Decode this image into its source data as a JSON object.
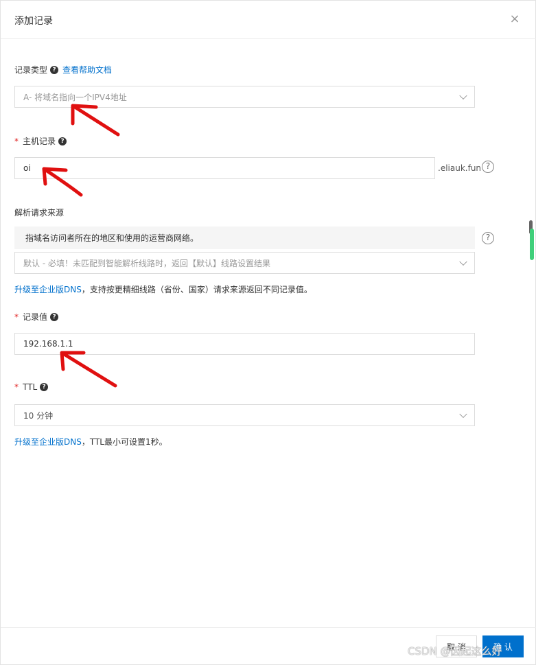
{
  "dialog": {
    "title": "添加记录",
    "close_glyph": "×"
  },
  "record_type": {
    "label": "记录类型",
    "help_link": "查看帮助文档",
    "value": "A- 将域名指向一个IPV4地址"
  },
  "host_record": {
    "label": "主机记录",
    "value": "oi",
    "suffix": ".eliauk.fun"
  },
  "resolve_source": {
    "label": "解析请求来源",
    "notice": "指域名访问者所在的地区和使用的运营商网络。",
    "value": "默认 - 必填！未匹配到智能解析线路时，返回【默认】线路设置结果",
    "upgrade_link": "升级至企业版DNS",
    "upgrade_text": "，支持按更精细线路（省份、国家）请求来源返回不同记录值。"
  },
  "record_value": {
    "label": "记录值",
    "value": "192.168.1.1"
  },
  "ttl": {
    "label": "TTL",
    "value": "10 分钟",
    "upgrade_link": "升级至企业版DNS",
    "upgrade_text": "，TTL最小可设置1秒。"
  },
  "footer": {
    "cancel_label": "取 消",
    "ok_label": "确 认"
  },
  "watermark": "CSDN @因起这么好",
  "colors": {
    "accent": "#0070cc",
    "required": "#e02020",
    "annotation": "#e01010"
  },
  "icons": {
    "help": "question-circle-icon",
    "chevron": "chevron-down-icon",
    "close": "close-icon"
  }
}
